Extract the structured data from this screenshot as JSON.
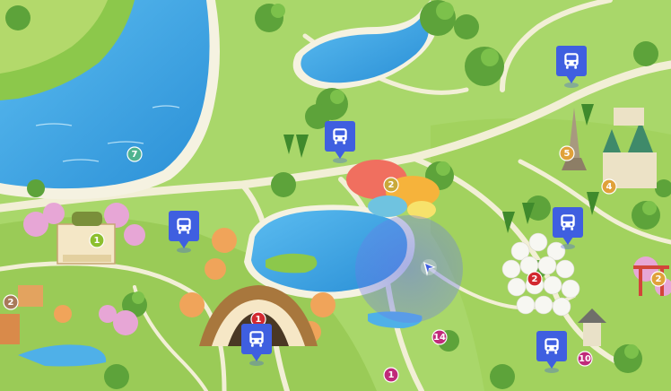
{
  "map": {
    "colors": {
      "grass_light": "#b5dc72",
      "grass_mid": "#8cc84b",
      "grass_dark": "#5fa63a",
      "path": "#f3f1d8",
      "water": "#2f9fe0",
      "water_light": "#7cc8f2",
      "shore": "#f4f1e0",
      "bus_pin": "#3f5fe0",
      "location_accuracy": "#6b79e8",
      "user_arrow": "#3f5fe0"
    },
    "numbered_markers": [
      {
        "id": "1",
        "label": "1",
        "color": "#8cbf2e"
      },
      {
        "id": "2",
        "label": "2",
        "color": "#c9a93a"
      },
      {
        "id": "2-pavilion",
        "label": "2",
        "color": "#d2282f"
      },
      {
        "id": "2-left",
        "label": "2",
        "color": "#a87a5a"
      },
      {
        "id": "2-right",
        "label": "2",
        "color": "#e0a13a"
      },
      {
        "id": "4",
        "label": "4",
        "color": "#e0a13a"
      },
      {
        "id": "5",
        "label": "5",
        "color": "#e0a13a"
      },
      {
        "id": "7",
        "label": "7",
        "color": "#4fb38f"
      },
      {
        "id": "10",
        "label": "10",
        "color": "#c02a7a"
      },
      {
        "id": "14",
        "label": "14",
        "color": "#c02a7a"
      },
      {
        "id": "1-bottom",
        "label": "1",
        "color": "#c02a7a"
      },
      {
        "id": "1-hall",
        "label": "1",
        "color": "#d2282f"
      }
    ],
    "bus_stops": [
      {
        "id": "bus-top-right",
        "icon": "bus-icon"
      },
      {
        "id": "bus-center-top",
        "icon": "bus-icon"
      },
      {
        "id": "bus-left",
        "icon": "bus-icon"
      },
      {
        "id": "bus-right",
        "icon": "bus-icon"
      },
      {
        "id": "bus-bottom-center",
        "icon": "bus-icon"
      },
      {
        "id": "bus-bottom-right",
        "icon": "bus-icon"
      }
    ],
    "user_location": {
      "icon": "navigation-arrow-icon"
    }
  }
}
